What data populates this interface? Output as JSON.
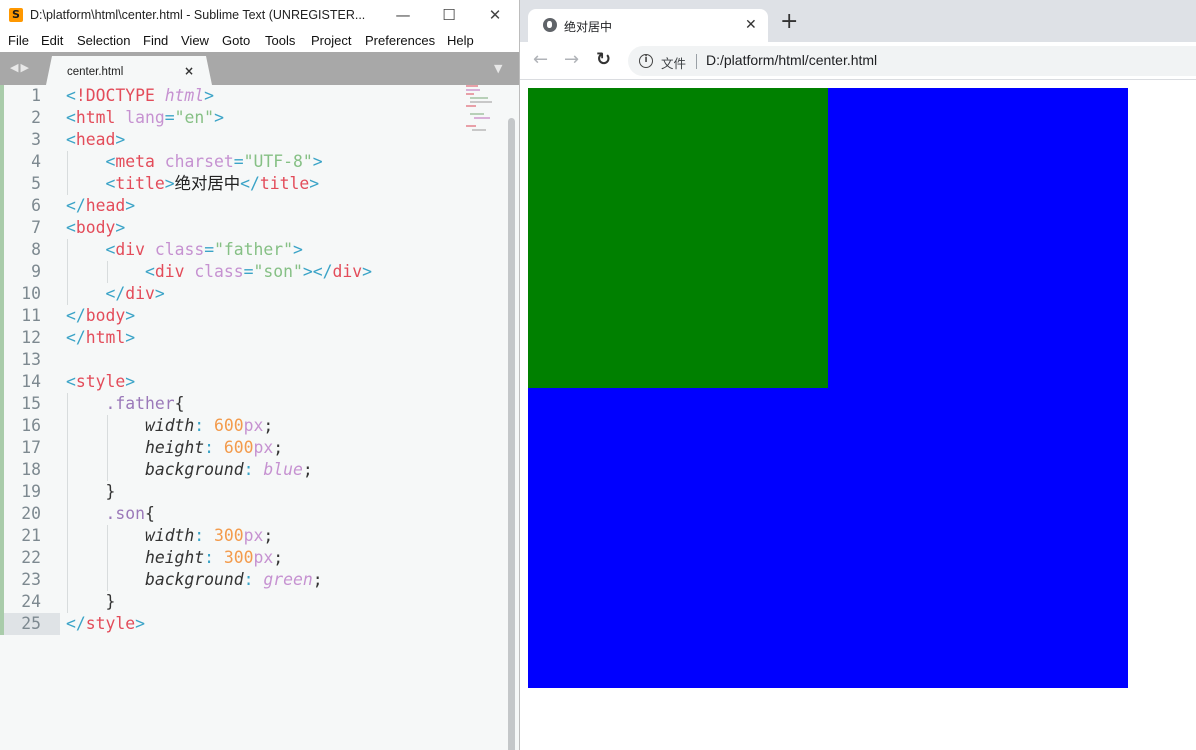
{
  "sublime": {
    "window_title": "D:\\platform\\html\\center.html - Sublime Text (UNREGISTER...",
    "app_icon_glyph": "S",
    "menu": [
      "File",
      "Edit",
      "Selection",
      "Find",
      "View",
      "Goto",
      "Tools",
      "Project",
      "Preferences",
      "Help"
    ],
    "tab_nav": "◀▶",
    "tab": {
      "label": "center.html",
      "close": "×"
    },
    "tab_dropdown": "▼",
    "window_buttons": {
      "minimize": "—",
      "maximize": "☐",
      "close": "✕"
    },
    "current_line": 25,
    "lines": [
      [
        [
          "punct",
          "<"
        ],
        [
          "tag",
          "!DOCTYPE "
        ],
        [
          "kw",
          "html"
        ],
        [
          "punct",
          ">"
        ]
      ],
      [
        [
          "punct",
          "<"
        ],
        [
          "tag",
          "html "
        ],
        [
          "attr",
          "lang"
        ],
        [
          "punct",
          "="
        ],
        [
          "str",
          "\"en\""
        ],
        [
          "punct",
          ">"
        ]
      ],
      [
        [
          "punct",
          "<"
        ],
        [
          "tag",
          "head"
        ],
        [
          "punct",
          ">"
        ]
      ],
      [
        [
          "plain",
          "    "
        ],
        [
          "punct",
          "<"
        ],
        [
          "tag",
          "meta "
        ],
        [
          "attr",
          "charset"
        ],
        [
          "punct",
          "="
        ],
        [
          "str",
          "\"UTF-8\""
        ],
        [
          "punct",
          ">"
        ]
      ],
      [
        [
          "plain",
          "    "
        ],
        [
          "punct",
          "<"
        ],
        [
          "tag",
          "title"
        ],
        [
          "punct",
          ">"
        ],
        [
          "cn",
          "绝对居中"
        ],
        [
          "punct",
          "</"
        ],
        [
          "tag",
          "title"
        ],
        [
          "punct",
          ">"
        ]
      ],
      [
        [
          "punct",
          "</"
        ],
        [
          "tag",
          "head"
        ],
        [
          "punct",
          ">"
        ]
      ],
      [
        [
          "punct",
          "<"
        ],
        [
          "tag",
          "body"
        ],
        [
          "punct",
          ">"
        ]
      ],
      [
        [
          "plain",
          "    "
        ],
        [
          "punct",
          "<"
        ],
        [
          "tag",
          "div "
        ],
        [
          "attr",
          "class"
        ],
        [
          "punct",
          "="
        ],
        [
          "str",
          "\"father\""
        ],
        [
          "punct",
          ">"
        ]
      ],
      [
        [
          "plain",
          "        "
        ],
        [
          "punct",
          "<"
        ],
        [
          "tag",
          "div "
        ],
        [
          "attr",
          "class"
        ],
        [
          "punct",
          "="
        ],
        [
          "str",
          "\"son\""
        ],
        [
          "punct",
          "></"
        ],
        [
          "tag",
          "div"
        ],
        [
          "punct",
          ">"
        ]
      ],
      [
        [
          "plain",
          "    "
        ],
        [
          "punct",
          "</"
        ],
        [
          "tag",
          "div"
        ],
        [
          "punct",
          ">"
        ]
      ],
      [
        [
          "punct",
          "</"
        ],
        [
          "tag",
          "body"
        ],
        [
          "punct",
          ">"
        ]
      ],
      [
        [
          "punct",
          "</"
        ],
        [
          "tag",
          "html"
        ],
        [
          "punct",
          ">"
        ]
      ],
      [],
      [
        [
          "punct",
          "<"
        ],
        [
          "tag",
          "style"
        ],
        [
          "punct",
          ">"
        ]
      ],
      [
        [
          "plain",
          "    "
        ],
        [
          "sel",
          ".father"
        ],
        [
          "plain",
          "{"
        ]
      ],
      [
        [
          "plain",
          "        "
        ],
        [
          "prop",
          "width"
        ],
        [
          "punct",
          ": "
        ],
        [
          "num",
          "600"
        ],
        [
          "unit",
          "px"
        ],
        [
          "plain",
          ";"
        ]
      ],
      [
        [
          "plain",
          "        "
        ],
        [
          "prop",
          "height"
        ],
        [
          "punct",
          ": "
        ],
        [
          "num",
          "600"
        ],
        [
          "unit",
          "px"
        ],
        [
          "plain",
          ";"
        ]
      ],
      [
        [
          "plain",
          "        "
        ],
        [
          "prop",
          "background"
        ],
        [
          "punct",
          ": "
        ],
        [
          "kw",
          "blue"
        ],
        [
          "plain",
          ";"
        ]
      ],
      [
        [
          "plain",
          "    }"
        ]
      ],
      [
        [
          "plain",
          "    "
        ],
        [
          "sel",
          ".son"
        ],
        [
          "plain",
          "{"
        ]
      ],
      [
        [
          "plain",
          "        "
        ],
        [
          "prop",
          "width"
        ],
        [
          "punct",
          ": "
        ],
        [
          "num",
          "300"
        ],
        [
          "unit",
          "px"
        ],
        [
          "plain",
          ";"
        ]
      ],
      [
        [
          "plain",
          "        "
        ],
        [
          "prop",
          "height"
        ],
        [
          "punct",
          ": "
        ],
        [
          "num",
          "300"
        ],
        [
          "unit",
          "px"
        ],
        [
          "plain",
          ";"
        ]
      ],
      [
        [
          "plain",
          "        "
        ],
        [
          "prop",
          "background"
        ],
        [
          "punct",
          ": "
        ],
        [
          "kw",
          "green"
        ],
        [
          "plain",
          ";"
        ]
      ],
      [
        [
          "plain",
          "    }"
        ]
      ],
      [
        [
          "punct",
          "</"
        ],
        [
          "tag",
          "style"
        ],
        [
          "punct",
          ">"
        ]
      ]
    ]
  },
  "chrome": {
    "tab_title": "绝对居中",
    "tab_close": "✕",
    "new_tab": "+",
    "nav": {
      "back": "←",
      "forward": "→",
      "reload": "↻"
    },
    "info_glyph": "i",
    "security_label": "文件",
    "url": "D:/platform/html/center.html"
  },
  "page": {
    "father": {
      "background": "#0000ff"
    },
    "son": {
      "background": "#008000"
    }
  },
  "colors": {
    "editor_bg": "#f6f8f8",
    "tabbar_bg": "#a8a8a8",
    "chrome_tabstrip_bg": "#dee1e6",
    "omnibox_bg": "#f1f3f4"
  }
}
